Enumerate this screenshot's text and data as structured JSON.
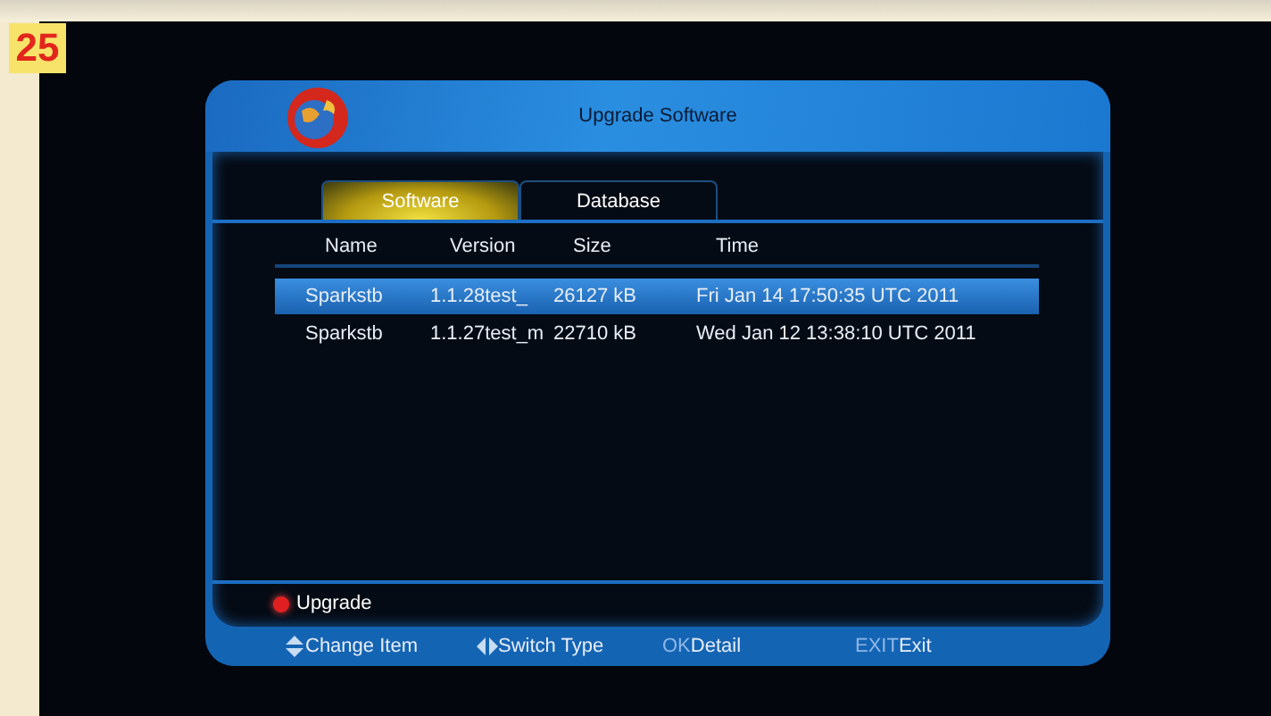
{
  "page_number": "25",
  "window": {
    "title": "Upgrade Software"
  },
  "tabs": [
    {
      "label": "Software",
      "selected": true
    },
    {
      "label": "Database",
      "selected": false
    }
  ],
  "table": {
    "columns": [
      "Name",
      "Version",
      "Size",
      "Time"
    ],
    "rows": [
      {
        "cells": [
          "Sparkstb",
          "1.1.28test_",
          "26127 kB",
          "Fri Jan 14 17:50:35 UTC 2011"
        ],
        "selected": true
      },
      {
        "cells": [
          "Sparkstb",
          "1.1.27test_m",
          "22710 kB",
          "Wed Jan 12 13:38:10 UTC 2011"
        ],
        "selected": false
      }
    ]
  },
  "action": {
    "label": "Upgrade",
    "color": "#e02020"
  },
  "hints": [
    {
      "kind": "updown",
      "label": "Change Item"
    },
    {
      "kind": "leftright",
      "label": "Switch Type"
    },
    {
      "kind": "key",
      "key": "OK",
      "label": "Detail"
    },
    {
      "kind": "key",
      "key": "EXIT",
      "label": "Exit"
    }
  ]
}
